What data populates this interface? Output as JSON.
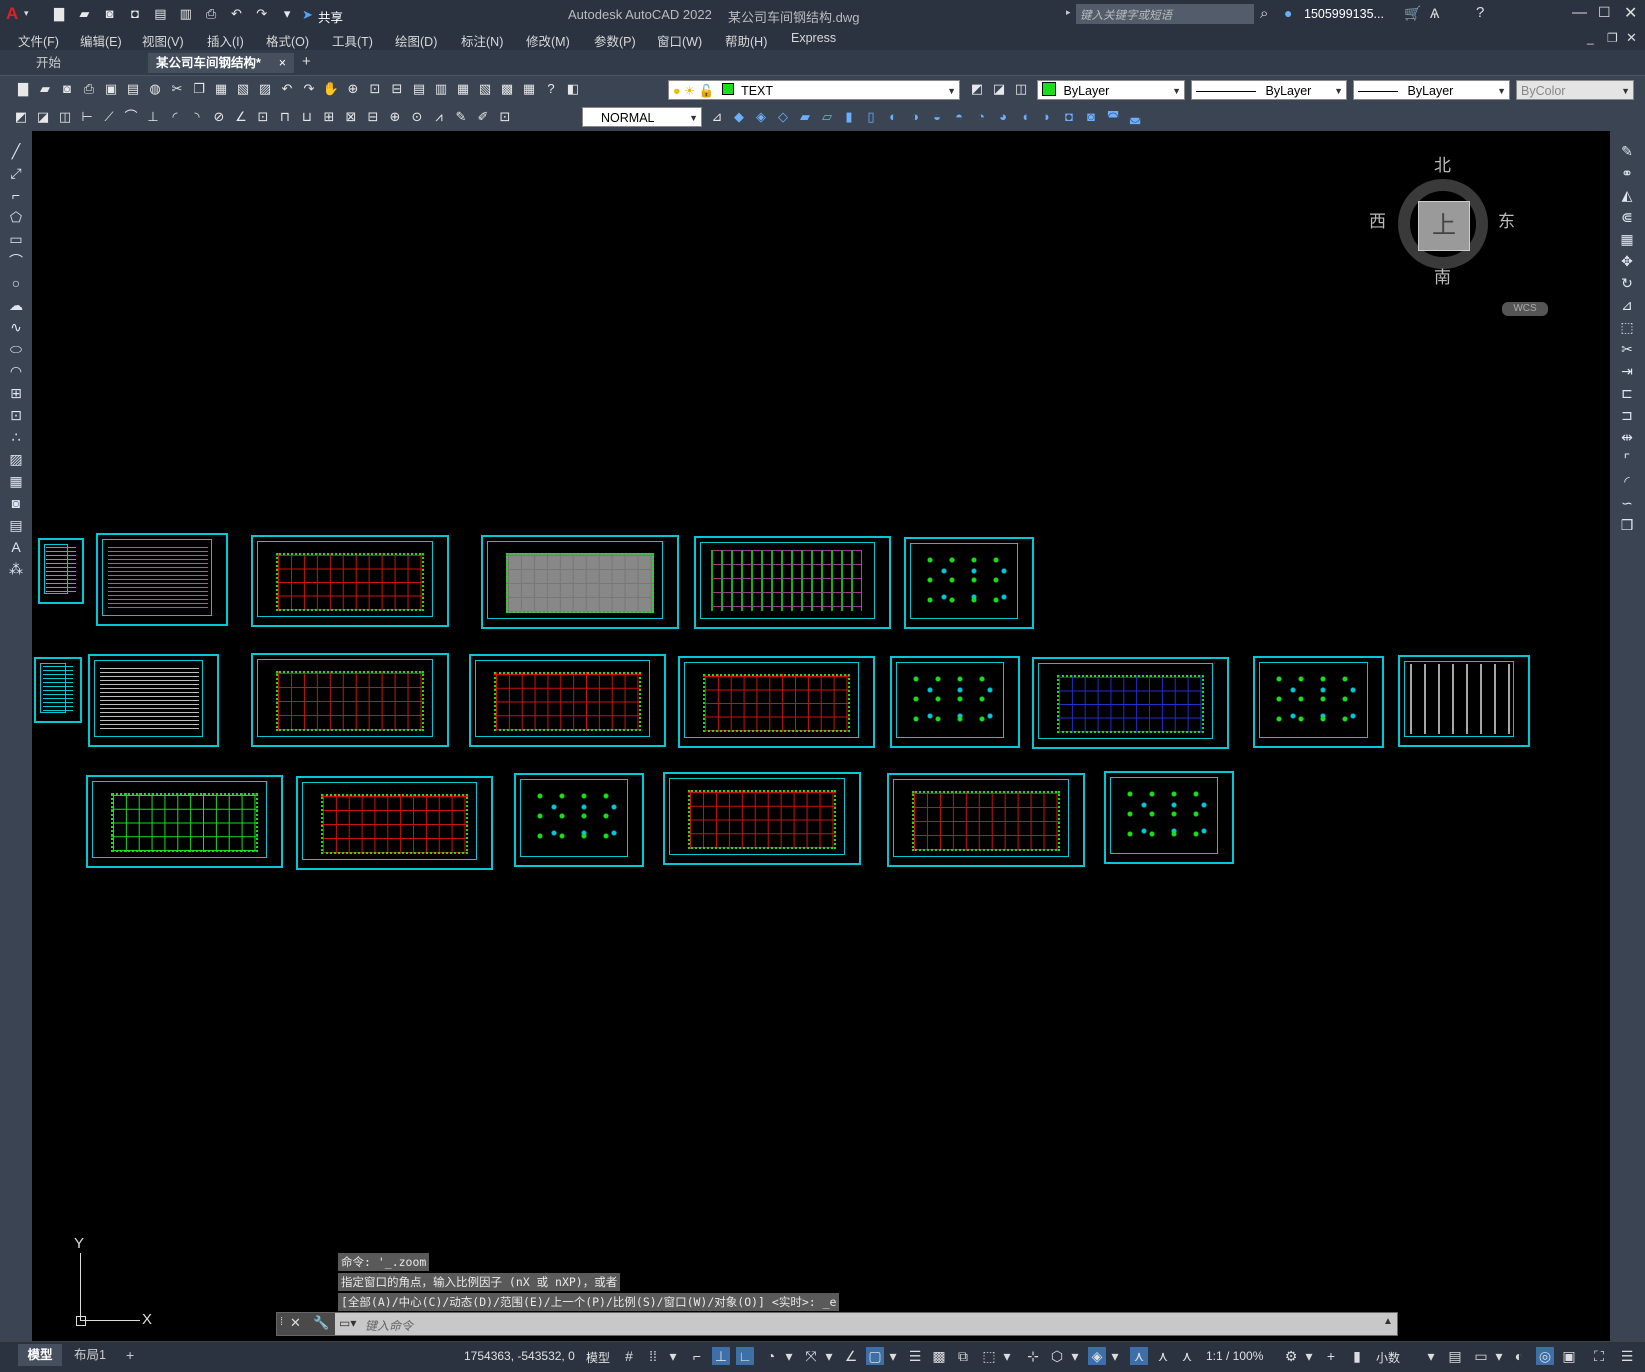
{
  "title": {
    "app": "Autodesk AutoCAD 2022",
    "file": "某公司车间钢结构.dwg",
    "share": "共享",
    "search_placeholder": "键入关键字或短语",
    "user": "1505999135...",
    "app_letter": "A"
  },
  "menu": [
    "文件(F)",
    "编辑(E)",
    "视图(V)",
    "插入(I)",
    "格式(O)",
    "工具(T)",
    "绘图(D)",
    "标注(N)",
    "修改(M)",
    "参数(P)",
    "窗口(W)",
    "帮助(H)",
    "Express"
  ],
  "tabs": {
    "start": "开始",
    "current": "某公司车间钢结构*",
    "close": "×",
    "add": "+"
  },
  "toolbar": {
    "layer": "TEXT",
    "color": "ByLayer",
    "linetype": "ByLayer",
    "lineweight": "ByLayer",
    "plotstyle": "ByColor",
    "dimstyle": "NORMAL"
  },
  "viewcube": {
    "north": "北",
    "south": "南",
    "east": "东",
    "west": "西",
    "top": "上",
    "wcs": "WCS"
  },
  "ucs": {
    "x": "X",
    "y": "Y"
  },
  "command": {
    "history": [
      "命令: '_.zoom",
      "指定窗口的角点，输入比例因子 (nX 或 nXP)，或者",
      "[全部(A)/中心(C)/动态(D)/范围(E)/上一个(P)/比例(S)/窗口(W)/对象(O)] <实时>: _e"
    ],
    "placeholder": "键入命令"
  },
  "status": {
    "layout_tabs": [
      "模型",
      "布局1"
    ],
    "add_layout": "+",
    "coords": "1754363, -543532, 0",
    "model": "模型",
    "scale": "1:1 / 100%",
    "units": "小数"
  },
  "colors": {
    "sheet_border": "#00c8d6",
    "grid": "#d01010",
    "green": "#18e018",
    "bg": "#000000",
    "ui": "#3b4453"
  },
  "sheets": [
    {
      "kind": "list"
    },
    {
      "kind": "text"
    },
    {
      "kind": "plan-grid"
    },
    {
      "kind": "plan-gray"
    },
    {
      "kind": "elevation"
    },
    {
      "kind": "detail"
    },
    {
      "kind": "list"
    },
    {
      "kind": "text-white"
    },
    {
      "kind": "plan-grid"
    },
    {
      "kind": "plan-grid"
    },
    {
      "kind": "plan-grid"
    },
    {
      "kind": "detail"
    },
    {
      "kind": "plan-blue"
    },
    {
      "kind": "detail"
    },
    {
      "kind": "section"
    },
    {
      "kind": "plan-green"
    },
    {
      "kind": "plan-grid"
    },
    {
      "kind": "detail"
    },
    {
      "kind": "plan-grid"
    },
    {
      "kind": "plan-grid"
    },
    {
      "kind": "detail"
    }
  ]
}
